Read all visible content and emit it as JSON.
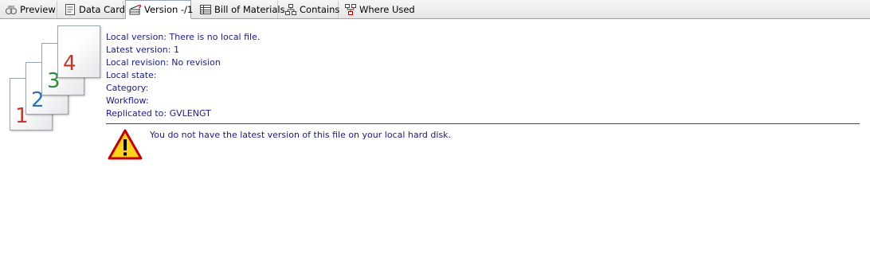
{
  "tabs": [
    {
      "label": "Preview",
      "icon": "preview-icon",
      "active": false
    },
    {
      "label": "Data Card",
      "icon": "data-card-icon",
      "active": false
    },
    {
      "label": "Version -/1",
      "icon": "version-icon",
      "active": true
    },
    {
      "label": "Bill of Materials",
      "icon": "bill-of-materials-icon",
      "active": false
    },
    {
      "label": "Contains",
      "icon": "contains-icon",
      "active": false
    },
    {
      "label": "Where Used",
      "icon": "where-used-icon",
      "active": false
    }
  ],
  "version_stack": {
    "pages": [
      "1",
      "2",
      "3",
      "4"
    ],
    "colors": [
      "#c0392b",
      "#2e6fb5",
      "#2e8b3c",
      "#c0392b"
    ]
  },
  "details": [
    "Local version: There is no local file.",
    "Latest version: 1",
    "Local revision: No revision",
    "Local state:",
    "Category:",
    "Workflow:",
    "Replicated to: GVLENGT"
  ],
  "warning": {
    "icon": "warning-triangle-icon",
    "message": "You do not have the latest version of this file on your local hard disk."
  }
}
